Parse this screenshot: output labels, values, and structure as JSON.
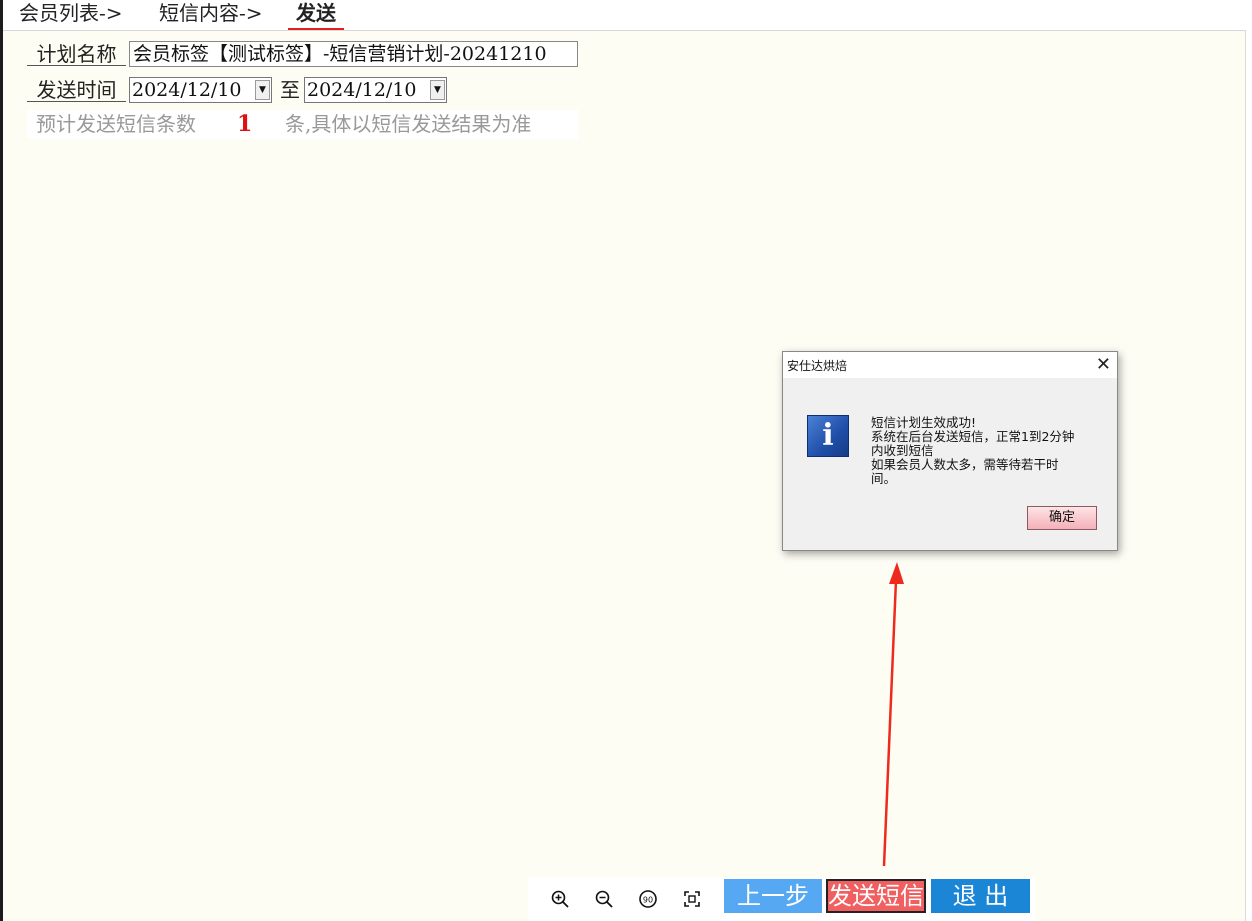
{
  "tabs": [
    {
      "label": "会员列表->"
    },
    {
      "label": "短信内容->"
    },
    {
      "label": "发送"
    }
  ],
  "form": {
    "plan_name_label": "计划名称",
    "plan_name_value": "会员标签【测试标签】-短信营销计划-20241210",
    "send_time_label": "发送时间",
    "start_date": "2024/12/10",
    "to_label": "至",
    "end_date": "2024/12/10",
    "estimate_prefix": "预计发送短信条数",
    "estimate_count": "1",
    "estimate_suffix": "条,具体以短信发送结果为准"
  },
  "toolbar": {
    "zoom_in_icon": "zoom-in-icon",
    "zoom_out_icon": "zoom-out-icon",
    "rotate_icon": "rotate-90-icon",
    "rotate_label": "90",
    "fit_icon": "fit-screen-icon",
    "prev_label": "上一步",
    "send_label": "发送短信",
    "exit_label": "退 出"
  },
  "dialog": {
    "title": "安仕达烘焙",
    "close_glyph": "✕",
    "icon": "info-icon",
    "lines": [
      "短信计划生效成功!",
      "系统在后台发送短信，正常1到2分钟",
      "内收到短信",
      "如果会员人数太多，需等待若干时",
      "间。"
    ],
    "ok_label": "确定"
  },
  "colors": {
    "background": "#fdfdf4",
    "active_tab_underline": "#e02020",
    "prev_button": "#56a8f3",
    "send_button": "#f06060",
    "exit_button": "#1c86d6",
    "annotation_arrow": "#ee2a1e"
  }
}
